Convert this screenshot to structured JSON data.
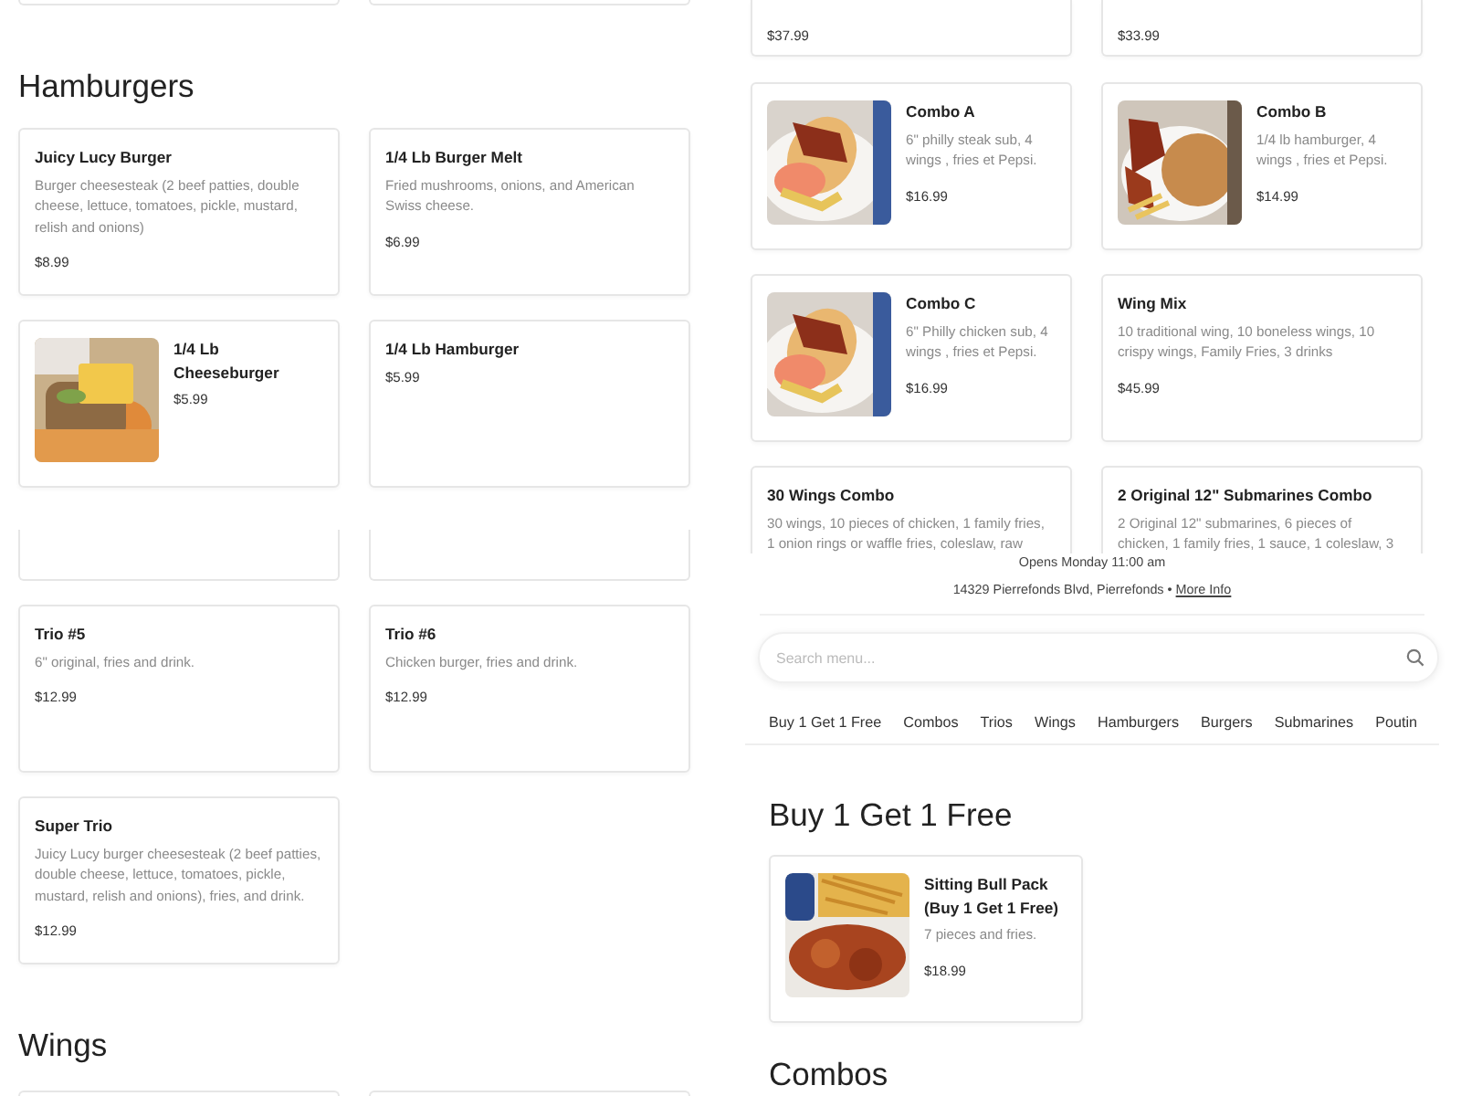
{
  "columns": [
    {
      "panels": [
        {
          "blocks": [
            {
              "kind": "card_bottoms"
            },
            {
              "kind": "heading",
              "text": "Hamburgers"
            },
            {
              "kind": "cards",
              "items": [
                {
                  "title": "Juicy Lucy Burger",
                  "description": "Burger cheesesteak (2 beef patties, double cheese, lettuce, tomatoes, pickle, mustard, relish and onions)",
                  "price": "$8.99"
                },
                {
                  "title": "1/4 Lb Burger Melt",
                  "description": "Fried mushrooms, onions, and American Swiss cheese.",
                  "price": "$6.99"
                },
                {
                  "title": "1/4 Lb Cheeseburger",
                  "price": "$5.99",
                  "photo": true
                },
                {
                  "title": "1/4 Lb Hamburger",
                  "price": "$5.99"
                }
              ]
            }
          ]
        },
        {
          "blocks": [
            {
              "kind": "card_bottoms"
            },
            {
              "kind": "cards",
              "items": [
                {
                  "title": "Trio #5",
                  "description": "6\" original, fries and drink.",
                  "price": "$12.99"
                },
                {
                  "title": "Trio #6",
                  "description": "Chicken burger, fries and drink.",
                  "price": "$12.99"
                },
                {
                  "title": "Super Trio",
                  "description": "Juicy Lucy burger cheesesteak (2 beef patties, double cheese, lettuce, tomatoes, pickle, mustard, relish and onions), fries, and drink.",
                  "price": "$12.99"
                }
              ]
            },
            {
              "kind": "heading",
              "text": "Wings"
            },
            {
              "kind": "card_tops"
            }
          ]
        }
      ]
    },
    {
      "panels": [
        {
          "blocks": [
            {
              "kind": "cut_cards",
              "items": [
                {
                  "price": "$37.99"
                },
                {
                  "price": "$33.99"
                }
              ]
            },
            {
              "kind": "cards",
              "items": [
                {
                  "title": "Combo A",
                  "description": "6\" philly steak sub, 4 wings , fries et Pepsi.",
                  "price": "$16.99",
                  "photo": true
                },
                {
                  "title": "Combo B",
                  "description": "1/4 lb hamburger, 4 wings , fries et Pepsi.",
                  "price": "$14.99",
                  "photo": true
                },
                {
                  "title": "Combo C",
                  "description": "6\" Philly chicken sub, 4 wings , fries et Pepsi.",
                  "price": "$16.99",
                  "photo": true
                },
                {
                  "title": "Wing Mix",
                  "description": "10 traditional wing, 10 boneless wings, 10 crispy wings, Family Fries, 3 drinks",
                  "price": "$45.99"
                },
                {
                  "title": "30 Wings Combo",
                  "description": "30 wings, 10 pieces of chicken, 1 family fries, 1 onion rings or waffle fries, coleslaw, raw"
                },
                {
                  "title": "2 Original 12\" Submarines Combo",
                  "description": "2 Original 12\" submarines, 6 pieces of chicken, 1 family fries, 1 sauce, 1 coleslaw, 3"
                }
              ]
            }
          ]
        },
        {
          "blocks": [
            {
              "kind": "info",
              "hours": "Opens Monday 11:00 am",
              "address": "14329 Pierrefonds Blvd, Pierrefonds •",
              "link": "More Info"
            },
            {
              "kind": "search",
              "placeholder": "Search menu..."
            },
            {
              "kind": "tabs",
              "items": [
                {
                  "label": "Buy 1 Get 1 Free",
                  "selected": false
                },
                {
                  "label": "Combos",
                  "selected": false
                },
                {
                  "label": "Trios",
                  "selected": false
                },
                {
                  "label": "Wings",
                  "selected": false
                },
                {
                  "label": "Hamburgers",
                  "selected": false
                },
                {
                  "label": "Burgers",
                  "selected": false
                },
                {
                  "label": "Submarines",
                  "selected": false
                },
                {
                  "label": "Poutin",
                  "selected": false
                }
              ]
            },
            {
              "kind": "heading",
              "text": "Buy 1 Get 1 Free"
            },
            {
              "kind": "cards",
              "items": [
                {
                  "title": "Sitting Bull Pack (Buy 1 Get 1 Free)",
                  "description": "7 pieces and fries.",
                  "price": "$18.99",
                  "photo": true
                }
              ]
            },
            {
              "kind": "heading",
              "text": "Combos"
            }
          ]
        }
      ]
    }
  ]
}
